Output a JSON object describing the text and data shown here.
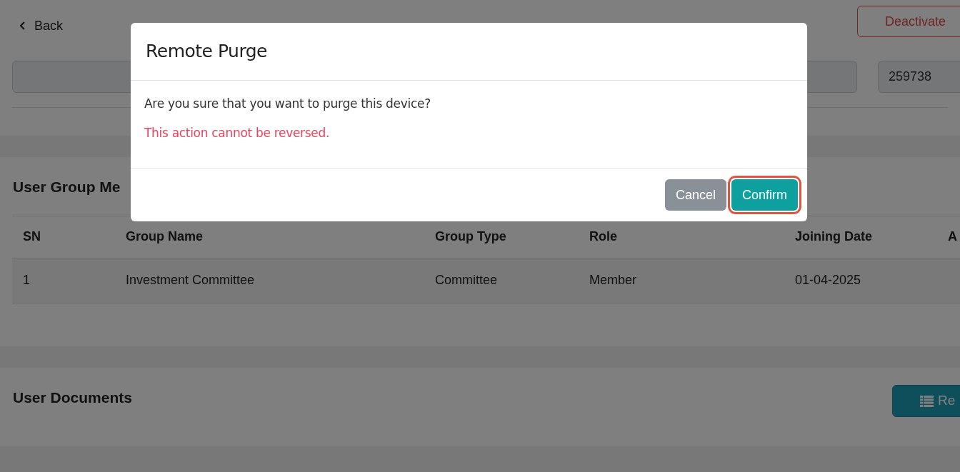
{
  "top_bar": {
    "back": "Back",
    "action": "Deactivate"
  },
  "fields": [
    {
      "kind": "wide"
    },
    {
      "kind": "narrow",
      "value": "259738"
    }
  ],
  "group_section": {
    "title": "User Group Me",
    "columns": [
      "SN",
      "Group Name",
      "Group Type",
      "Role",
      "Joining Date",
      "A"
    ],
    "rows": [
      [
        "1",
        "Investment Committee",
        "Committee",
        "Member",
        "01-04-2025"
      ]
    ]
  },
  "documents": {
    "title": "User Documents",
    "button": "Re"
  },
  "modal": {
    "title": "Remote Purge",
    "message": "Are you sure that you want to purge this device?",
    "warning": "This action cannot be reversed.",
    "buttons": [
      {
        "label": "Cancel",
        "kind": "secondary",
        "focused": false
      },
      {
        "label": "Confirm",
        "kind": "primary",
        "focused": true
      }
    ]
  }
}
